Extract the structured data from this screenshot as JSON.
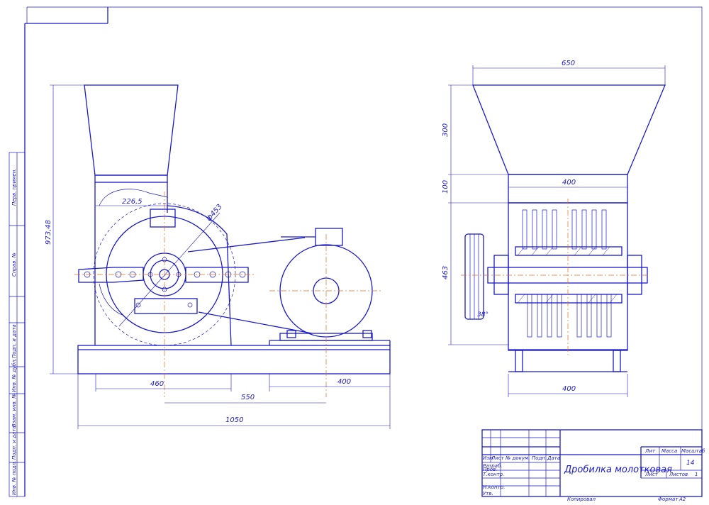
{
  "drawing": {
    "title": "Дробилка молотковая",
    "scale_label": "Масштаб",
    "scale_value": "14",
    "mass_label": "Масса",
    "lit_label": "Лит",
    "sheet_label": "Лист",
    "sheets_label": "Листов",
    "sheets_value": "1",
    "copied_label": "Копировал",
    "format_label": "Формат",
    "format_value": "A2"
  },
  "title_block": {
    "col_headers": [
      "Изм",
      "Лист",
      "№ докум.",
      "Подп.",
      "Дата"
    ],
    "row_labels": [
      "Разраб.",
      "Пров.",
      "Т.контр.",
      "Н.контр.",
      "Утв."
    ]
  },
  "side_stamps": [
    "Перв. примен.",
    "Справ. №",
    "Подп. и дата",
    "Инв. № дубл.",
    "Взам. инв. №",
    "Подп. и дата",
    "Инв. № подл."
  ],
  "front_view": {
    "dims": {
      "total_length": "1050",
      "left_span": "460",
      "mid_span": "550",
      "right_span": "400",
      "height": "973,48",
      "offset": "226,5",
      "diameter": "ф453"
    }
  },
  "side_view": {
    "dims": {
      "hopper_top": "650",
      "hopper_throat": "400",
      "base_width": "400",
      "hopper_h": "300",
      "neck_h": "100",
      "body_h": "463",
      "angle": "38°"
    }
  }
}
